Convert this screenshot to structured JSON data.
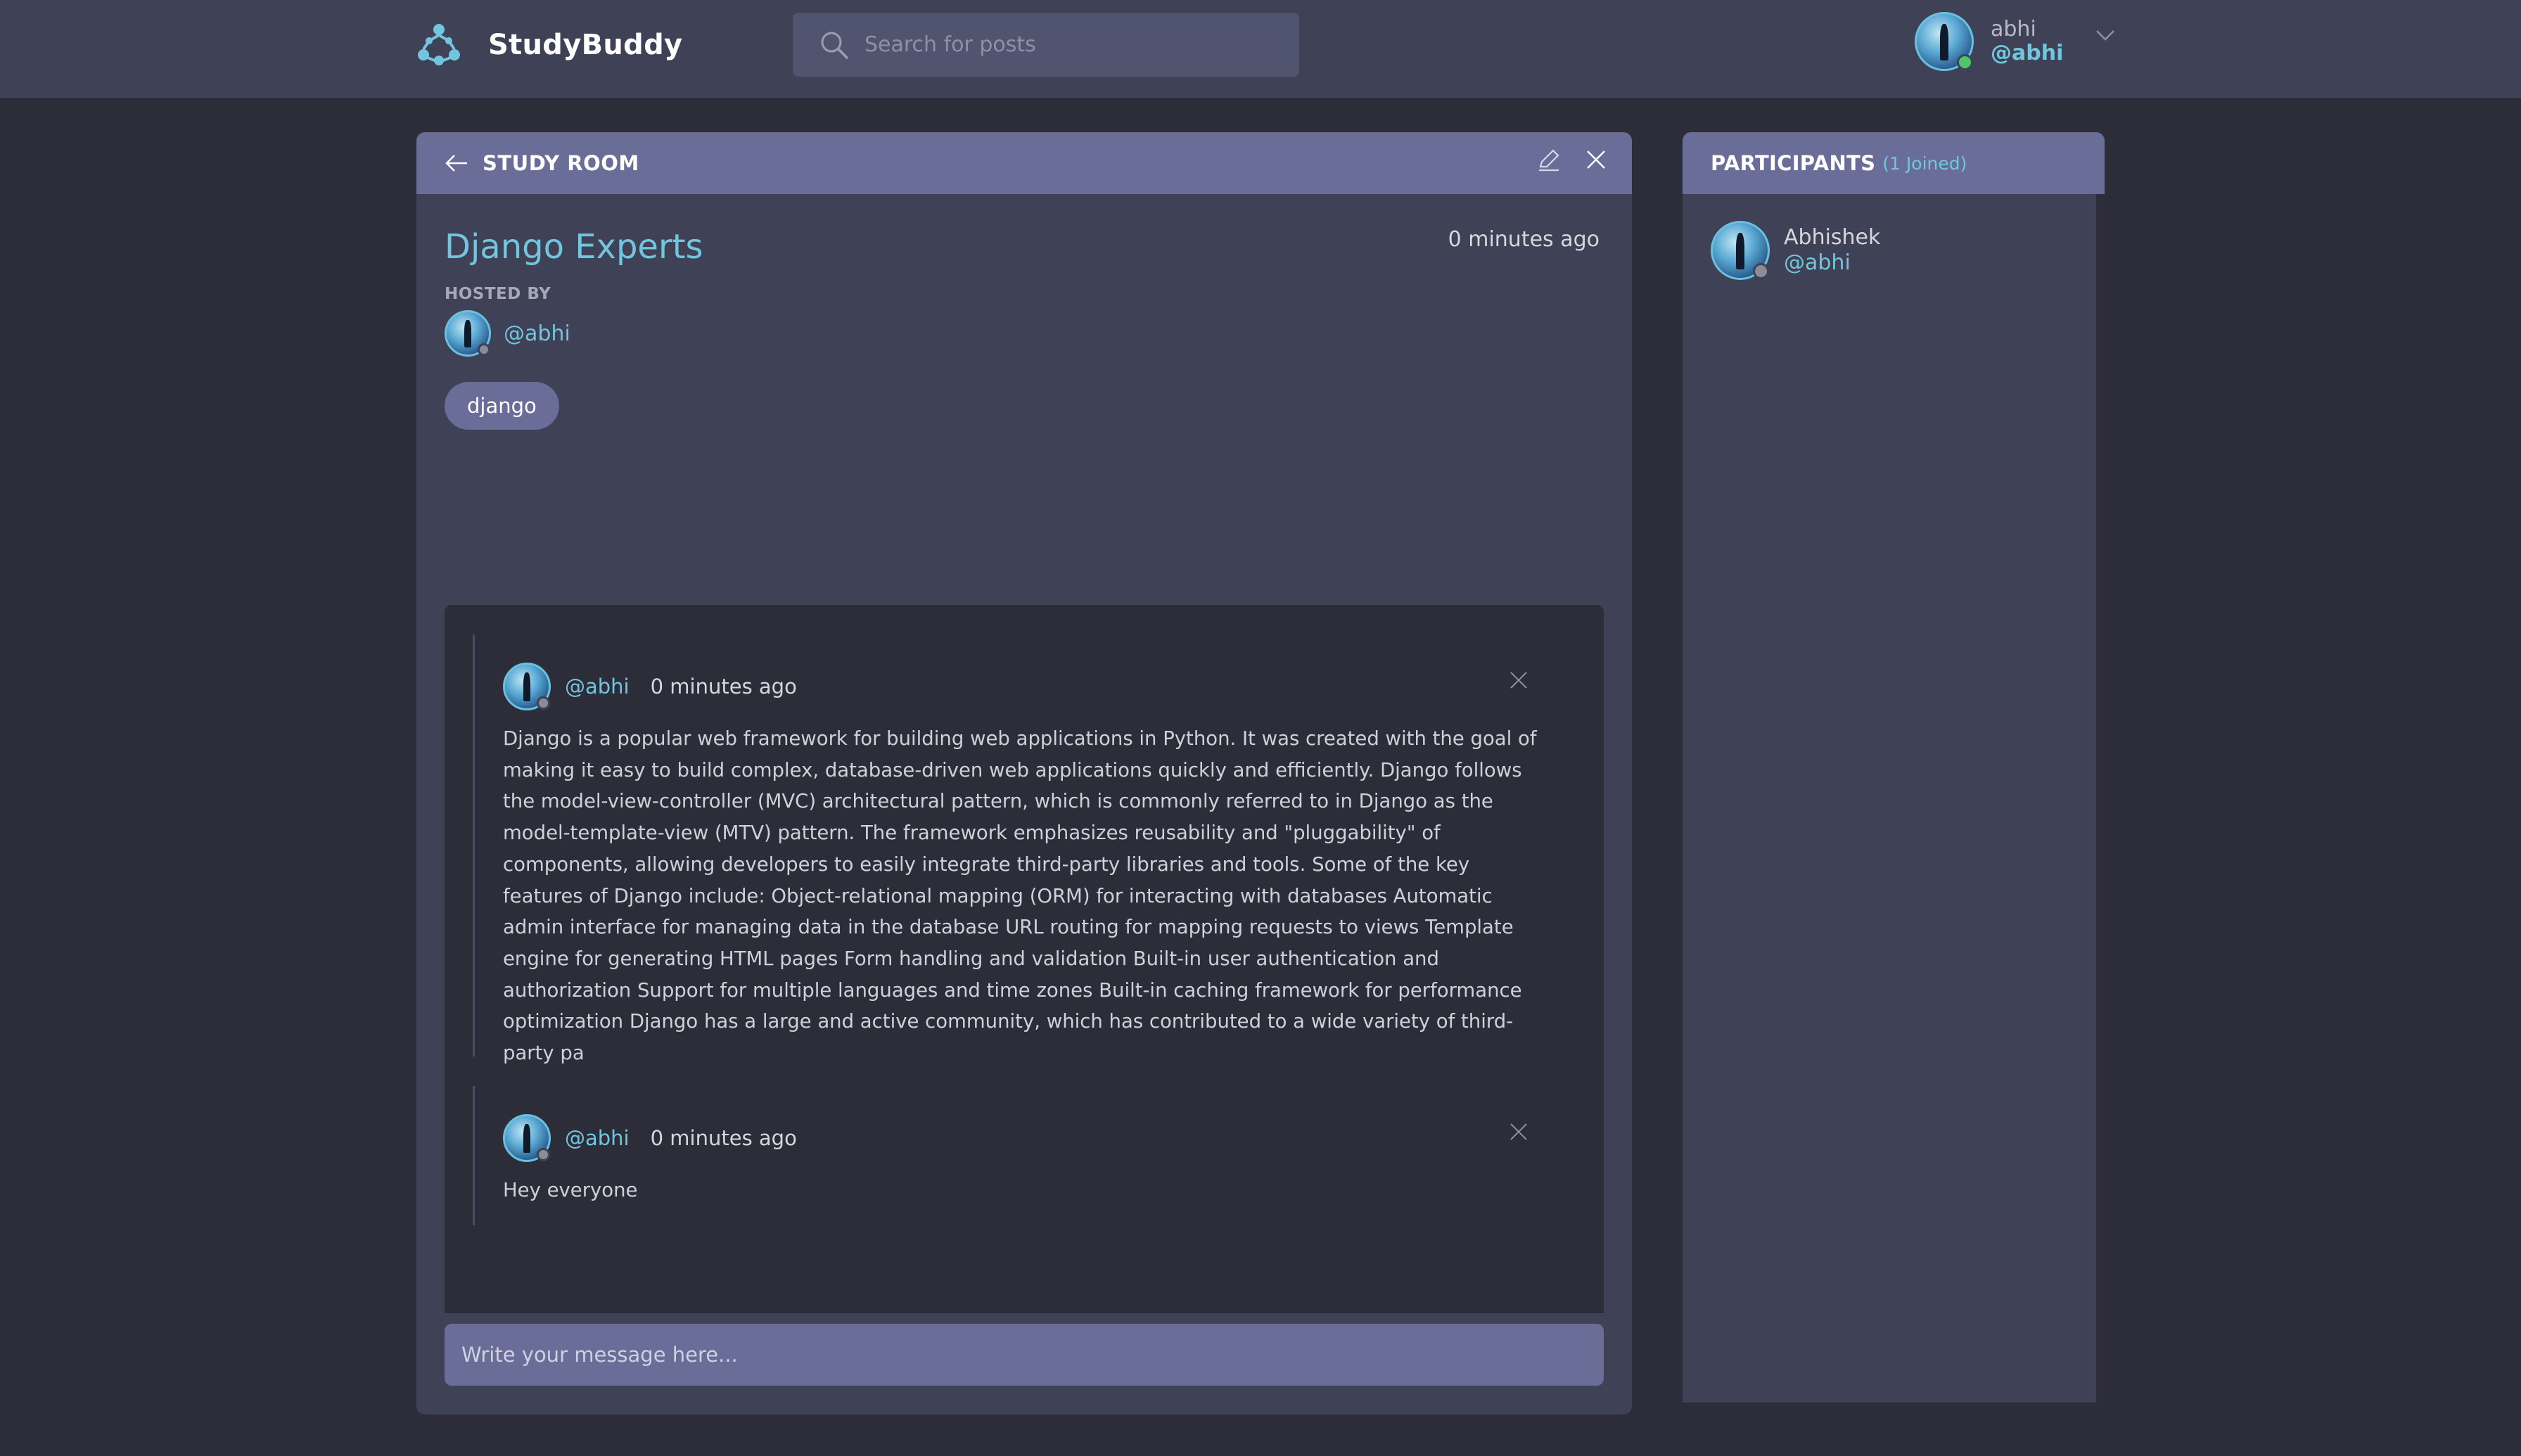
{
  "app": {
    "name": "StudyBuddy",
    "logo_icon": "molecule-icon",
    "colors": {
      "background": "#2d2d39",
      "panel": "#3f4156",
      "panel_header": "#696d97",
      "accent": "#71c6dd",
      "online": "#4fc56a"
    }
  },
  "search": {
    "placeholder": "Search for posts",
    "icon": "search-icon"
  },
  "user": {
    "name": "abhi",
    "handle": "@abhi",
    "status": "online"
  },
  "room": {
    "header_label": "STUDY ROOM",
    "name": "Django Experts",
    "time": "0 minutes ago",
    "hosted_by_label": "HOSTED BY",
    "host_handle": "@abhi",
    "topic_tag": "django"
  },
  "messages": [
    {
      "handle": "@abhi",
      "time": "0 minutes ago",
      "body": "Django is a popular web framework for building web applications in Python. It was created with the goal of making it easy to build complex, database-driven web applications quickly and efficiently. Django follows the model-view-controller (MVC) architectural pattern, which is commonly referred to in Django as the model-template-view (MTV) pattern. The framework emphasizes reusability and \"pluggability\" of components, allowing developers to easily integrate third-party libraries and tools. Some of the key features of Django include: Object-relational mapping (ORM) for interacting with databases Automatic admin interface for managing data in the database URL routing for mapping requests to views Template engine for generating HTML pages Form handling and validation Built-in user authentication and authorization Support for multiple languages and time zones Built-in caching framework for performance optimization Django has a large and active community, which has contributed to a wide variety of third-party pa"
    },
    {
      "handle": "@abhi",
      "time": "0 minutes ago",
      "body": "Hey everyone"
    }
  ],
  "composer": {
    "placeholder": "Write your message here..."
  },
  "participants": {
    "title": "PARTICIPANTS",
    "count_label": "(1 Joined)",
    "list": [
      {
        "name": "Abhishek",
        "handle": "@abhi"
      }
    ]
  }
}
